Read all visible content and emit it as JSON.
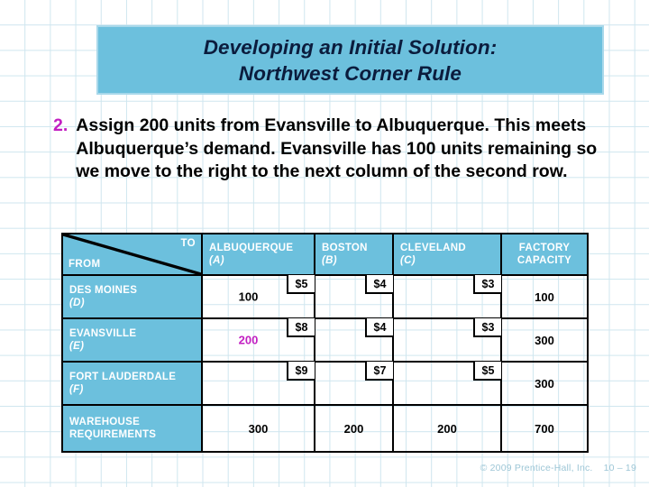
{
  "slide": {
    "title_lines": [
      "Developing an Initial Solution:",
      "Northwest Corner Rule"
    ],
    "bullet": {
      "number": "2.",
      "text": "Assign 200 units from Evansville to Albuquerque. This meets Albuquerque’s demand. Evansville has 100 units remaining so we move to the right to the next column of the second row."
    },
    "footer": {
      "copyright": "© 2009 Prentice-Hall, Inc.",
      "page": "10 – 19"
    }
  },
  "colors": {
    "banner_blue": "#6cc0dd",
    "banner_border": "#a8d8ea",
    "header_text": "#ffffff",
    "highlight_magenta": "#c21fc2",
    "body_text": "#000000",
    "title_text": "#0b1c3d",
    "footer_text": "#9dc6d6",
    "grid_line": "#cfe6ef"
  },
  "table": {
    "corner": {
      "to_label": "TO",
      "from_label": "FROM"
    },
    "columns": [
      {
        "name": "ALBUQUERQUE",
        "code": "(A)"
      },
      {
        "name": "BOSTON",
        "code": "(B)"
      },
      {
        "name": "CLEVELAND",
        "code": "(C)"
      }
    ],
    "capacity_header_line1": "FACTORY",
    "capacity_header_line2": "CAPACITY",
    "rows": [
      {
        "name": "DES MOINES",
        "code": "(D)",
        "cells": [
          {
            "cost": "$5",
            "alloc": "100",
            "highlight": false
          },
          {
            "cost": "$4",
            "alloc": "",
            "highlight": false
          },
          {
            "cost": "$3",
            "alloc": "",
            "highlight": false
          }
        ],
        "capacity": "100"
      },
      {
        "name": "EVANSVILLE",
        "code": "(E)",
        "cells": [
          {
            "cost": "$8",
            "alloc": "200",
            "highlight": true
          },
          {
            "cost": "$4",
            "alloc": "",
            "highlight": false
          },
          {
            "cost": "$3",
            "alloc": "",
            "highlight": false
          }
        ],
        "capacity": "300"
      },
      {
        "name": "FORT LAUDERDALE",
        "code": "(F)",
        "cells": [
          {
            "cost": "$9",
            "alloc": "",
            "highlight": false
          },
          {
            "cost": "$7",
            "alloc": "",
            "highlight": false
          },
          {
            "cost": "$5",
            "alloc": "",
            "highlight": false
          }
        ],
        "capacity": "300"
      }
    ],
    "requirements_row": {
      "label_line1": "WAREHOUSE",
      "label_line2": "REQUIREMENTS",
      "values": [
        "300",
        "200",
        "200"
      ],
      "total": "700"
    }
  }
}
